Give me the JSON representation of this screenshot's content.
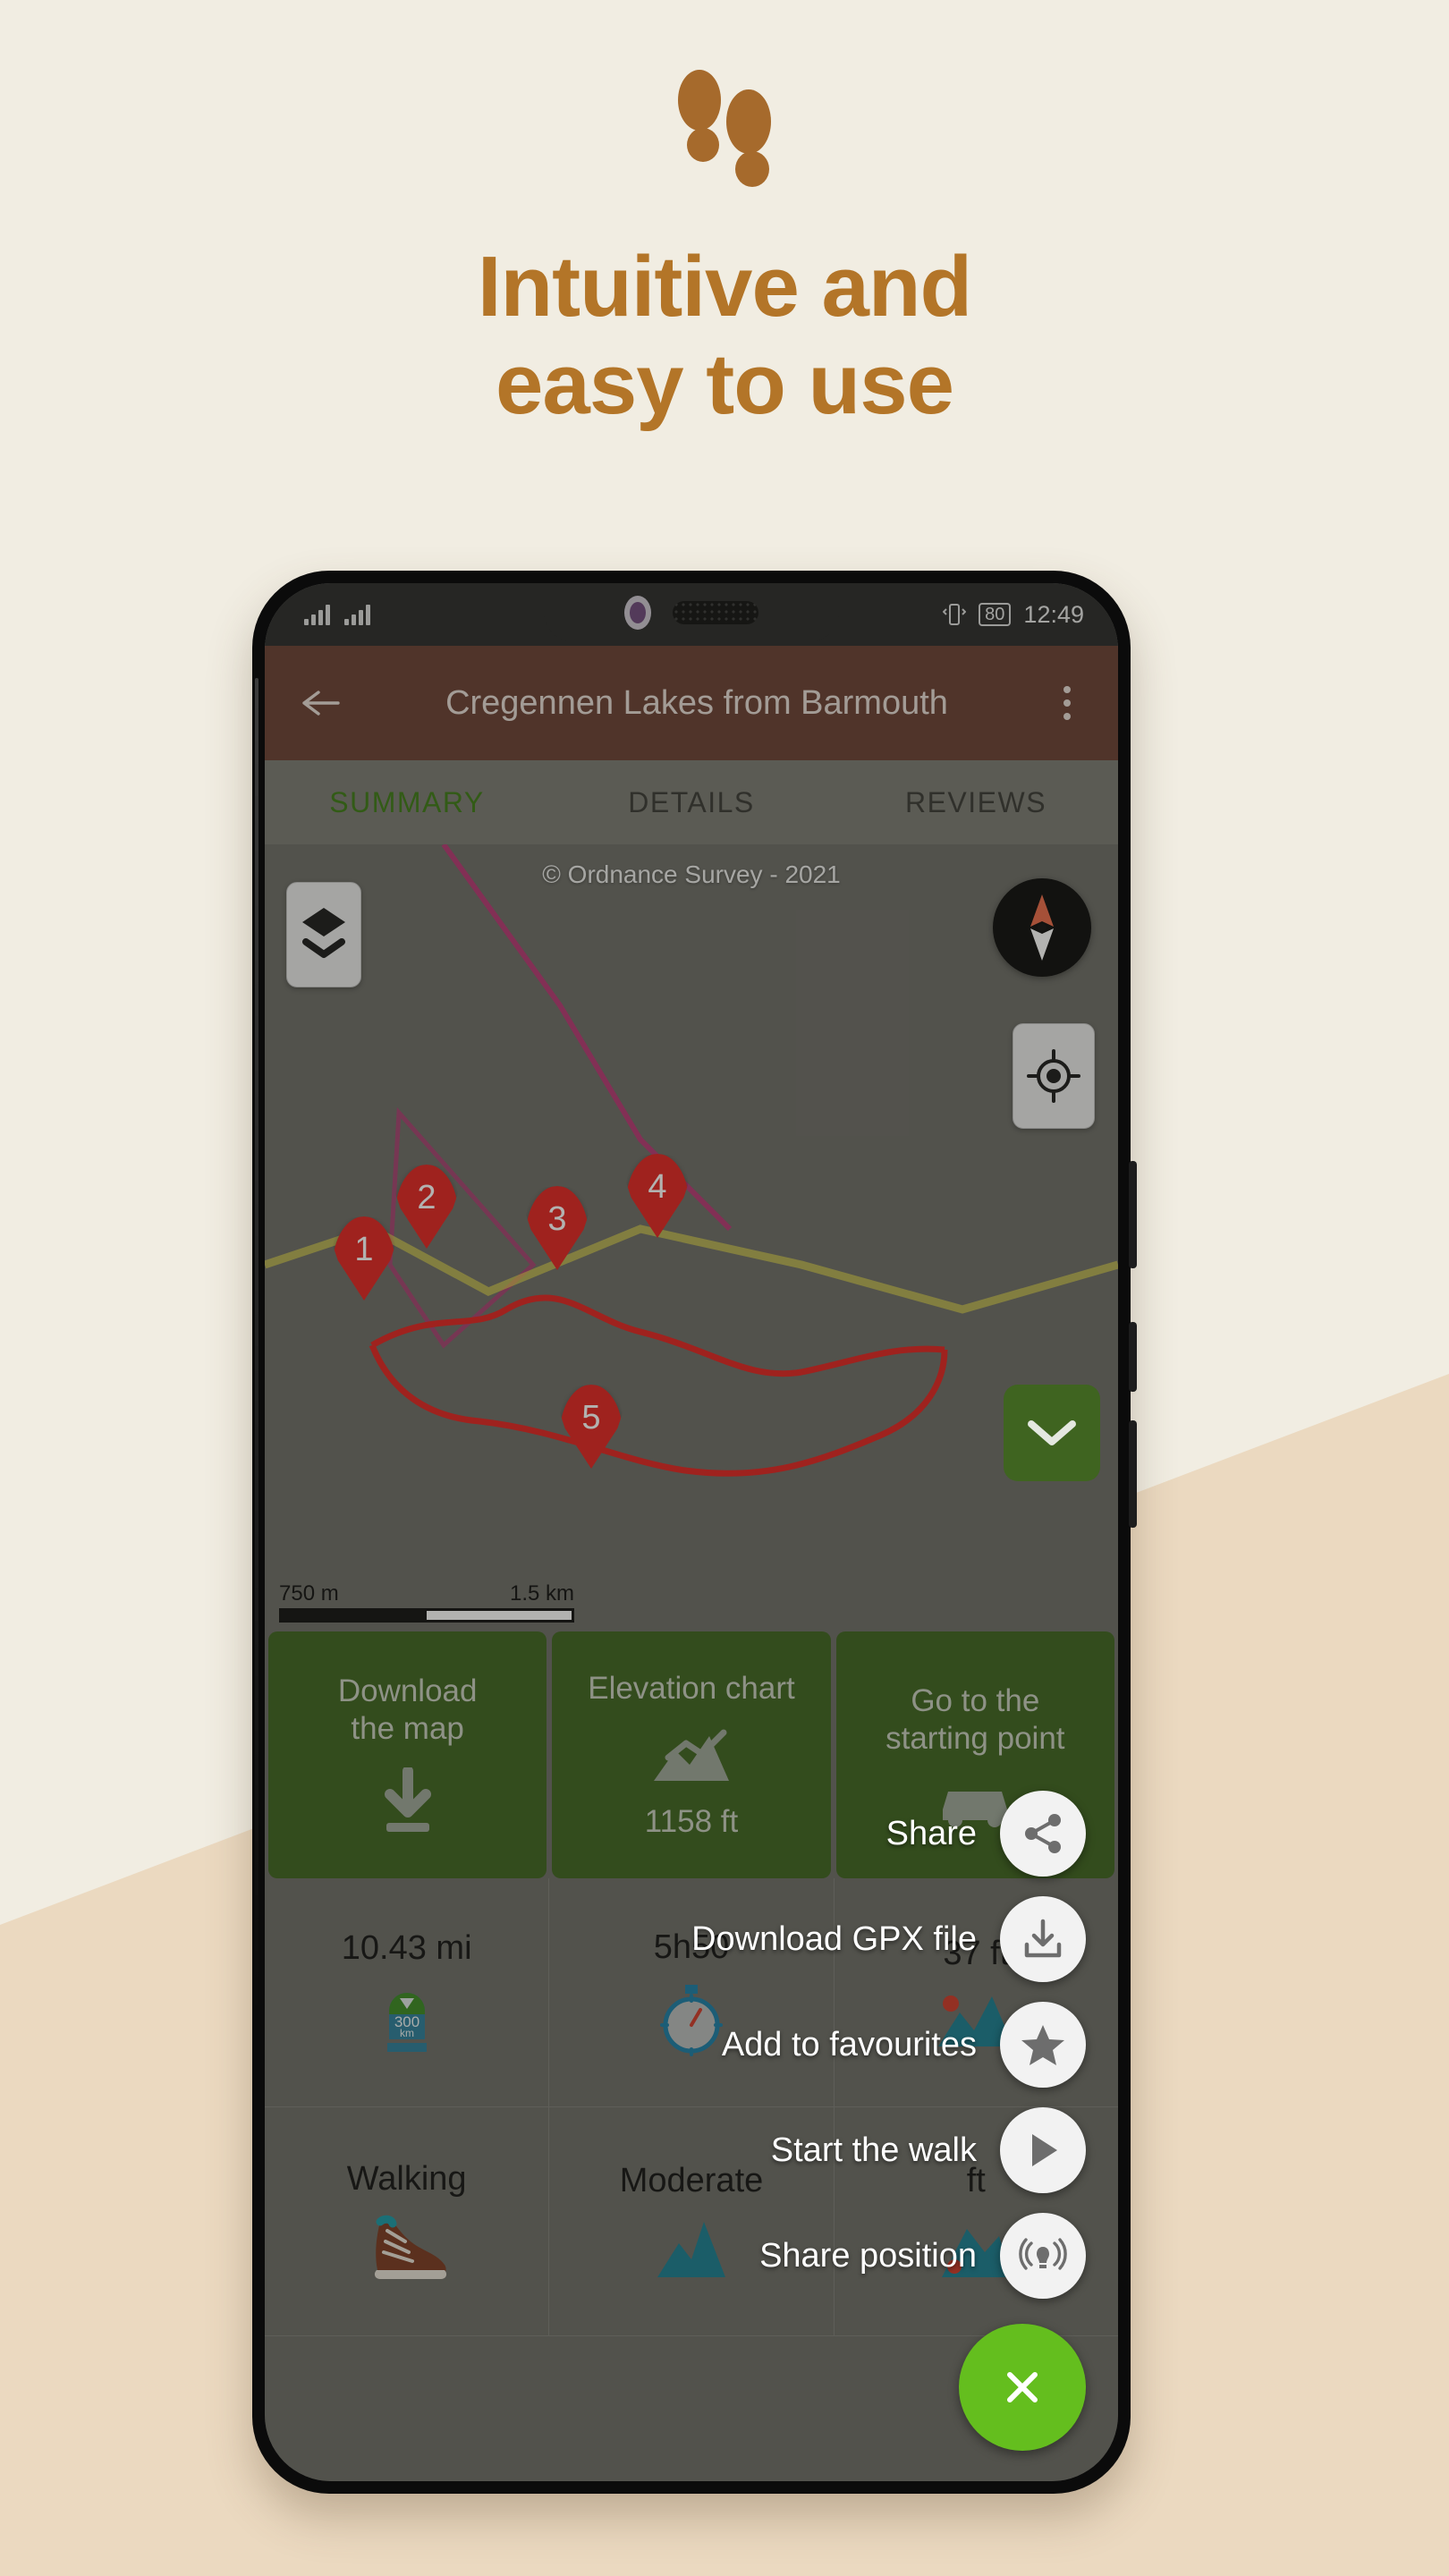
{
  "promo": {
    "icon": "footprints-icon",
    "title_line1": "Intuitive and",
    "title_line2": "easy to use",
    "title_color": "#B37528",
    "bg_color": "#F1EDE2",
    "wedge_color": "#EBD9C0"
  },
  "status_bar": {
    "battery": "80",
    "time": "12:49",
    "vibrate_icon": "vibrate-icon",
    "signal_icon": "signal-bars-icon"
  },
  "app_bar": {
    "back_icon": "arrow-left-icon",
    "title": "Cregennen Lakes from Barmouth",
    "more_icon": "overflow-menu-icon",
    "color": "#6B4035"
  },
  "tabs": [
    {
      "label": "SUMMARY",
      "active": true
    },
    {
      "label": "DETAILS",
      "active": false
    },
    {
      "label": "REVIEWS",
      "active": false
    }
  ],
  "map": {
    "attribution": "© Ordnance Survey - 2021",
    "layers_icon": "layers-icon",
    "compass_icon": "compass-icon",
    "locate_icon": "my-location-icon",
    "markers": [
      "1",
      "2",
      "3",
      "4",
      "5"
    ],
    "scale_mid": "750 m",
    "scale_end": "1.5 km",
    "route_color": "#E32522"
  },
  "tiles": [
    {
      "label": "Download\nthe map",
      "label_l1": "Download",
      "label_l2": "the map",
      "icon": "download-icon",
      "sub": ""
    },
    {
      "label": "Elevation chart",
      "label_l1": "Elevation chart",
      "label_l2": "",
      "icon": "elevation-chart-icon",
      "sub": "1158 ft"
    },
    {
      "label": "Go to the starting point",
      "label_l1": "Go to the",
      "label_l2": "starting point",
      "icon": "car-icon",
      "sub": ""
    }
  ],
  "stats": [
    {
      "value": "10.43 mi",
      "icon": "distance-marker-icon",
      "icon_text": "300 km"
    },
    {
      "value": "5h50",
      "icon": "stopwatch-icon"
    },
    {
      "value": "37 ft",
      "icon": "mountain-icon"
    }
  ],
  "stats_row2": [
    {
      "value": "Walking",
      "icon": "hiking-boot-icon"
    },
    {
      "value": "Moderate",
      "icon": "mountain-icon"
    },
    {
      "value": "ft",
      "icon": "mountain-icon"
    }
  ],
  "speed_dial": {
    "items": [
      {
        "label": "Share",
        "icon": "share-icon"
      },
      {
        "label": "Download GPX file",
        "icon": "download-file-icon"
      },
      {
        "label": "Add to favourites",
        "icon": "star-icon"
      },
      {
        "label": "Start the walk",
        "icon": "play-icon"
      },
      {
        "label": "Share position",
        "icon": "broadcast-icon"
      }
    ],
    "close_icon": "close-icon",
    "close_color": "#64BE1E",
    "collapse_icon": "chevron-down-icon"
  }
}
